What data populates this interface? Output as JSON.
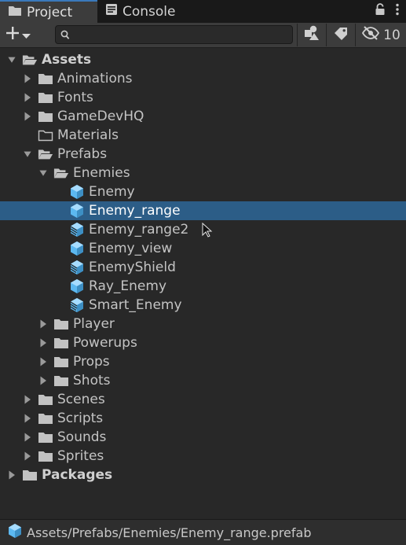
{
  "tabs": {
    "project_label": "Project",
    "console_label": "Console"
  },
  "toolbar": {
    "search_placeholder": "",
    "hidden_count": "10"
  },
  "tree": [
    {
      "label": "Assets",
      "indent": 0,
      "arrow": "down",
      "icon": "folder-open",
      "bold": true
    },
    {
      "label": "Animations",
      "indent": 1,
      "arrow": "right",
      "icon": "folder"
    },
    {
      "label": "Fonts",
      "indent": 1,
      "arrow": "right",
      "icon": "folder"
    },
    {
      "label": "GameDevHQ",
      "indent": 1,
      "arrow": "right",
      "icon": "folder"
    },
    {
      "label": "Materials",
      "indent": 1,
      "arrow": "none",
      "icon": "folder-empty"
    },
    {
      "label": "Prefabs",
      "indent": 1,
      "arrow": "down",
      "icon": "folder-open"
    },
    {
      "label": "Enemies",
      "indent": 2,
      "arrow": "down",
      "icon": "folder-open"
    },
    {
      "label": "Enemy",
      "indent": 3,
      "arrow": "none",
      "icon": "prefab"
    },
    {
      "label": "Enemy_range",
      "indent": 3,
      "arrow": "none",
      "icon": "prefab",
      "selected": true
    },
    {
      "label": "Enemy_range2",
      "indent": 3,
      "arrow": "none",
      "icon": "prefab-variant"
    },
    {
      "label": "Enemy_view",
      "indent": 3,
      "arrow": "none",
      "icon": "prefab"
    },
    {
      "label": "EnemyShield",
      "indent": 3,
      "arrow": "none",
      "icon": "prefab-variant"
    },
    {
      "label": "Ray_Enemy",
      "indent": 3,
      "arrow": "none",
      "icon": "prefab"
    },
    {
      "label": "Smart_Enemy",
      "indent": 3,
      "arrow": "none",
      "icon": "prefab-variant"
    },
    {
      "label": "Player",
      "indent": 2,
      "arrow": "right",
      "icon": "folder"
    },
    {
      "label": "Powerups",
      "indent": 2,
      "arrow": "right",
      "icon": "folder"
    },
    {
      "label": "Props",
      "indent": 2,
      "arrow": "right",
      "icon": "folder"
    },
    {
      "label": "Shots",
      "indent": 2,
      "arrow": "right",
      "icon": "folder"
    },
    {
      "label": "Scenes",
      "indent": 1,
      "arrow": "right",
      "icon": "folder"
    },
    {
      "label": "Scripts",
      "indent": 1,
      "arrow": "right",
      "icon": "folder"
    },
    {
      "label": "Sounds",
      "indent": 1,
      "arrow": "right",
      "icon": "folder"
    },
    {
      "label": "Sprites",
      "indent": 1,
      "arrow": "right",
      "icon": "folder"
    },
    {
      "label": "Packages",
      "indent": 0,
      "arrow": "right",
      "icon": "folder",
      "bold": true
    }
  ],
  "status": {
    "path": "Assets/Prefabs/Enemies/Enemy_range.prefab"
  },
  "colors": {
    "selection": "#2c5d87",
    "accent": "#3a79bb",
    "prefab": "#5cb8f0"
  }
}
